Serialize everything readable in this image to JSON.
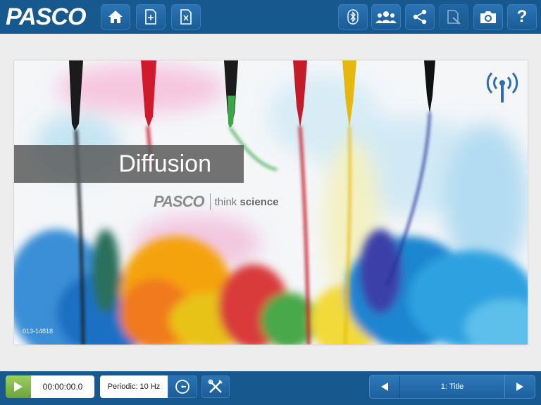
{
  "app": {
    "logo_text": "PASCO"
  },
  "toolbar": {
    "left": [
      {
        "name": "home-button",
        "icon": "home-icon"
      },
      {
        "name": "new-page-button",
        "icon": "add-page-icon"
      },
      {
        "name": "delete-page-button",
        "icon": "delete-page-icon"
      }
    ],
    "right": [
      {
        "name": "bluetooth-button",
        "icon": "bluetooth-icon"
      },
      {
        "name": "share-session-button",
        "icon": "people-icon"
      },
      {
        "name": "share-button",
        "icon": "share-icon"
      },
      {
        "name": "journal-button",
        "icon": "journal-icon",
        "disabled": true
      },
      {
        "name": "camera-button",
        "icon": "camera-icon"
      },
      {
        "name": "help-button",
        "icon": "help-icon",
        "label": "?"
      }
    ]
  },
  "slide": {
    "title": "Diffusion",
    "brand_logo": "PASCO",
    "tagline_prefix": "think ",
    "tagline_bold": "science",
    "code": "013-14818",
    "wireless_icon": "wireless-sensor-icon"
  },
  "bottombar": {
    "time": "00:00:00.0",
    "sampling": "Periodic: 10 Hz",
    "page_label": "1: Title"
  },
  "colors": {
    "bar": "#17588f",
    "button": "#1f66a5",
    "play": "#7ab547"
  }
}
